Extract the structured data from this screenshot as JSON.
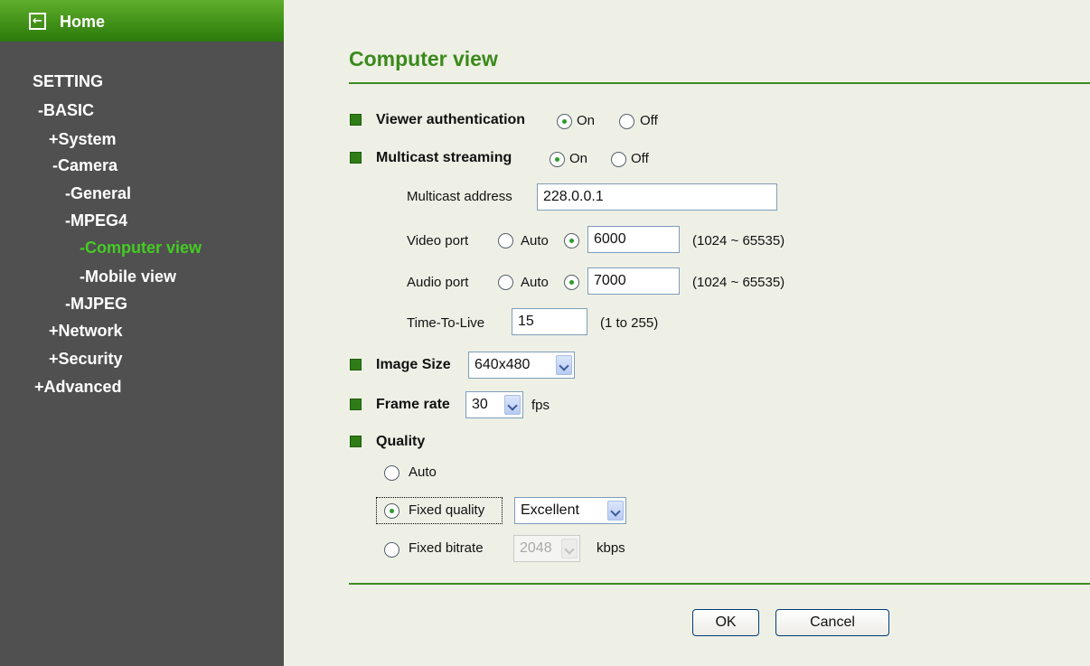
{
  "sidebar": {
    "home_label": "Home",
    "setting_label": "SETTING",
    "items": [
      {
        "prefix": "-",
        "label": "BASIC"
      },
      {
        "prefix": "+",
        "label": "System"
      },
      {
        "prefix": "-",
        "label": "Camera"
      },
      {
        "prefix": "-",
        "label": "General"
      },
      {
        "prefix": "-",
        "label": "MPEG4"
      },
      {
        "prefix": "-",
        "label": "Computer view"
      },
      {
        "prefix": "-",
        "label": "Mobile view"
      },
      {
        "prefix": "-",
        "label": "MJPEG"
      },
      {
        "prefix": "+",
        "label": "Network"
      },
      {
        "prefix": "+",
        "label": "Security"
      },
      {
        "prefix": "+",
        "label": "Advanced"
      }
    ],
    "active_item": "Computer view",
    "active_color": "#44cc22"
  },
  "page": {
    "title": "Computer view",
    "accent_color": "#3d8c22"
  },
  "form": {
    "viewer_auth": {
      "label": "Viewer authentication",
      "on_label": "On",
      "off_label": "Off",
      "selected": "On"
    },
    "multicast": {
      "label": "Multicast streaming",
      "on_label": "On",
      "off_label": "Off",
      "selected": "On"
    },
    "multicast_address": {
      "label": "Multicast address",
      "value": "228.0.0.1"
    },
    "video_port": {
      "label": "Video port",
      "auto_label": "Auto",
      "selected": "manual",
      "value": "6000",
      "range": "(1024 ~ 65535)"
    },
    "audio_port": {
      "label": "Audio port",
      "auto_label": "Auto",
      "selected": "manual",
      "value": "7000",
      "range": "(1024 ~ 65535)"
    },
    "ttl": {
      "label": "Time-To-Live",
      "value": "15",
      "range": "(1 to 255)"
    },
    "image_size": {
      "label": "Image Size",
      "value": "640x480"
    },
    "frame_rate": {
      "label": "Frame rate",
      "value": "30",
      "unit": "fps"
    },
    "quality": {
      "label": "Quality",
      "auto_label": "Auto",
      "fixed_quality_label": "Fixed quality",
      "fixed_quality_value": "Excellent",
      "fixed_bitrate_label": "Fixed bitrate",
      "fixed_bitrate_value": "2048",
      "bitrate_unit": "kbps",
      "selected": "Fixed quality"
    }
  },
  "buttons": {
    "ok": "OK",
    "cancel": "Cancel"
  }
}
